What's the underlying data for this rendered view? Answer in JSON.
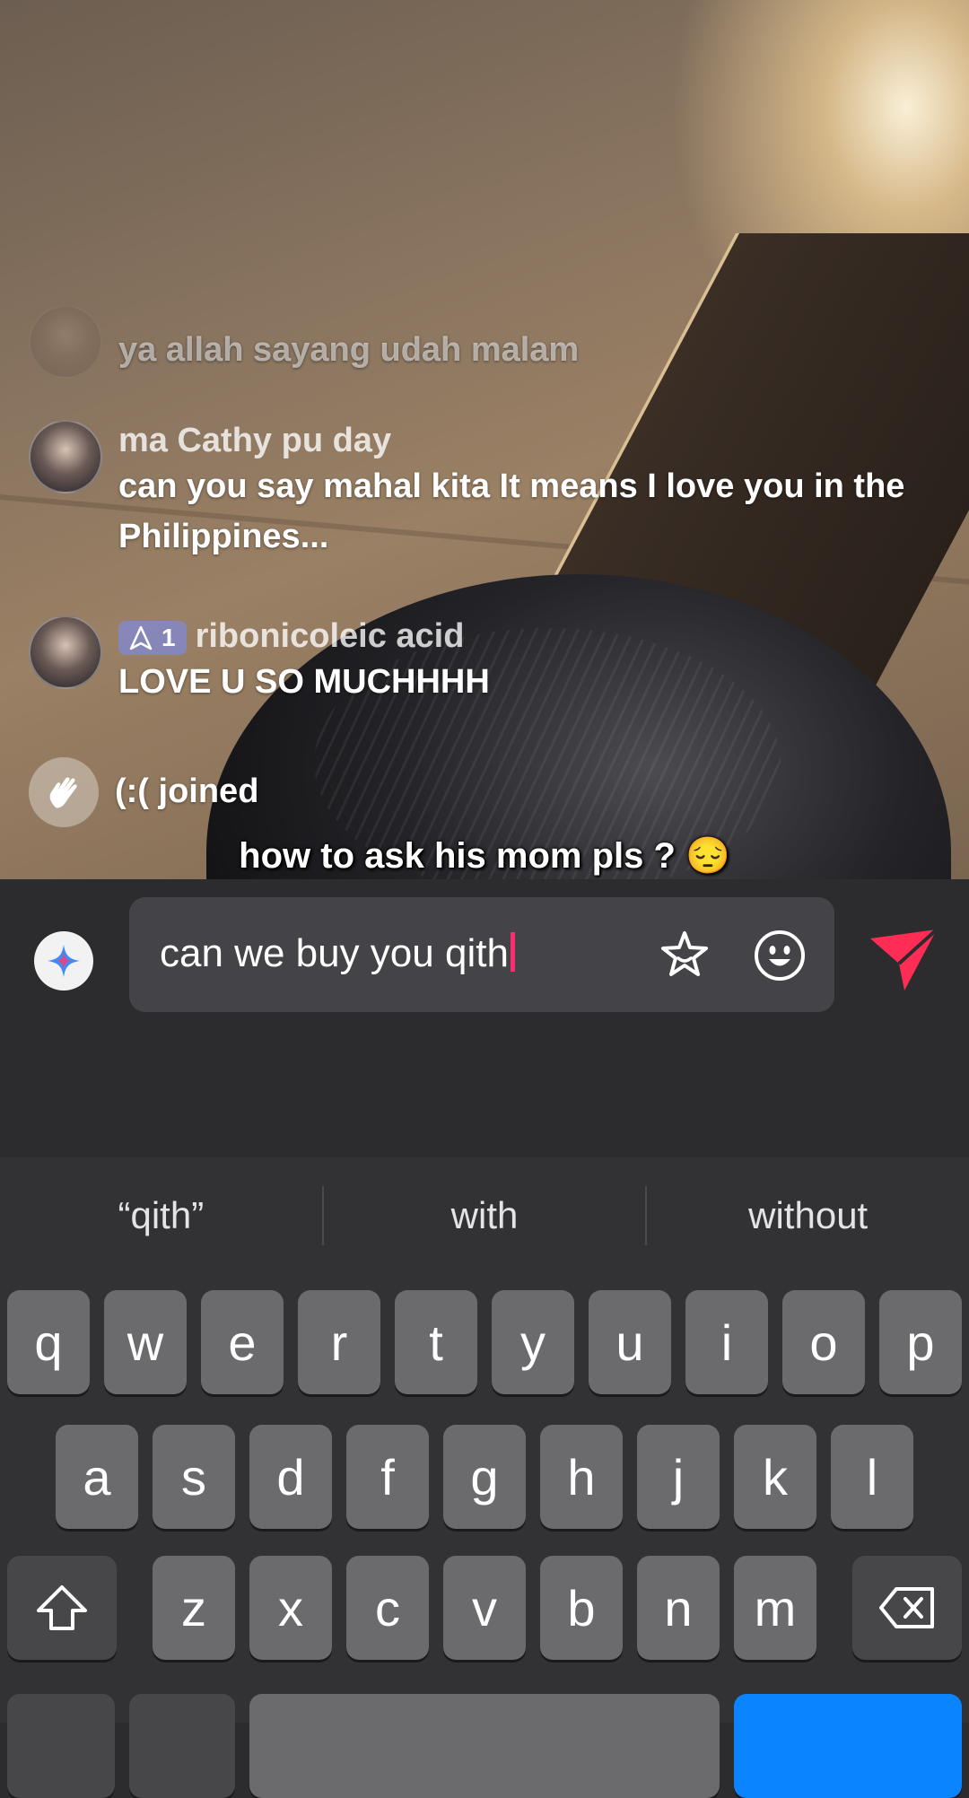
{
  "chat": {
    "messages": [
      {
        "name": "",
        "text": "ya allah sayang udah malam"
      },
      {
        "name": "ma Cathy pu day",
        "text": "can you say mahal kita It means I love you in the Philippines..."
      },
      {
        "badge": "1",
        "name": "ribonicoleic acid",
        "text": "LOVE U SO MUCHHHH"
      }
    ],
    "join_event": "(:( joined"
  },
  "caption": "how to ask his mom pls ? 😔",
  "composer": {
    "input_value": "can we buy you qith"
  },
  "keyboard": {
    "suggestions": [
      "“qith”",
      "with",
      "without"
    ],
    "rows": [
      [
        "q",
        "w",
        "e",
        "r",
        "t",
        "y",
        "u",
        "i",
        "o",
        "p"
      ],
      [
        "a",
        "s",
        "d",
        "f",
        "g",
        "h",
        "j",
        "k",
        "l"
      ],
      [
        "z",
        "x",
        "c",
        "v",
        "b",
        "n",
        "m"
      ]
    ]
  },
  "colors": {
    "send_accent": "#ff2d55",
    "caret": "#ff2d6f",
    "return_key": "#0a84ff"
  }
}
